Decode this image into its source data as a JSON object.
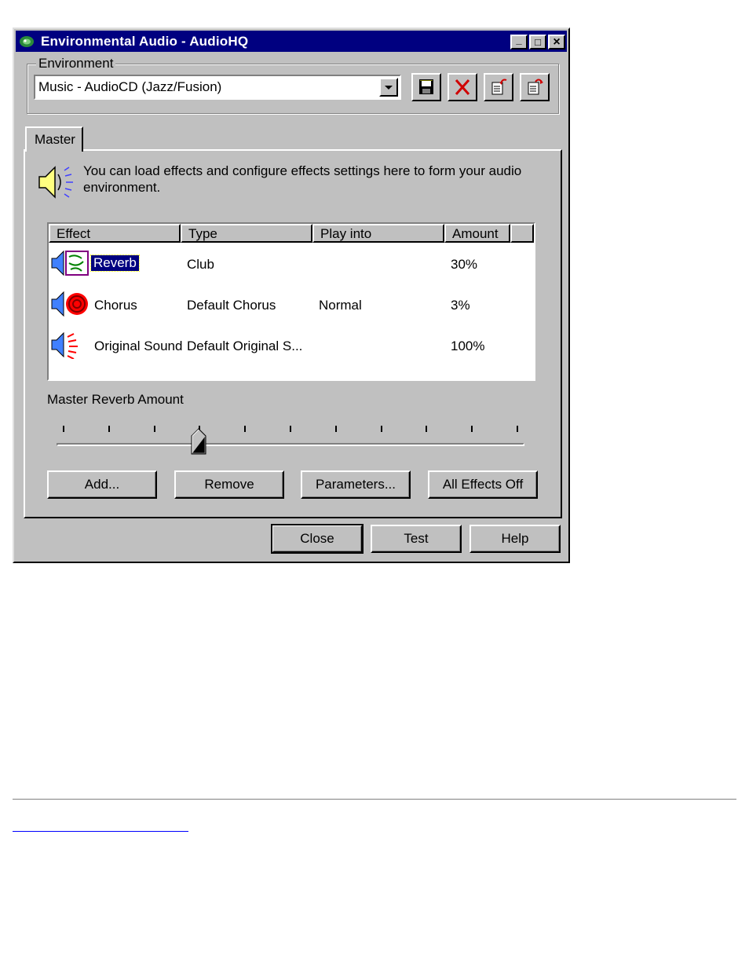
{
  "window": {
    "title": "Environmental Audio - AudioHQ",
    "controls": {
      "minimize": "_",
      "maximize": "□",
      "close": "×"
    }
  },
  "environment": {
    "group_label": "Environment",
    "selected": "Music - AudioCD (Jazz/Fusion)",
    "toolbar_icons": [
      "save-icon",
      "delete-icon",
      "import-icon",
      "export-icon"
    ]
  },
  "tabs": [
    {
      "label": "Master"
    }
  ],
  "info_text": "You can load effects and configure effects settings here to form your audio environment.",
  "effects_table": {
    "columns": [
      "Effect",
      "Type",
      "Play into",
      "Amount"
    ],
    "rows": [
      {
        "effect": "Reverb",
        "type": "Club",
        "play_into": "",
        "amount": "30%",
        "selected": true
      },
      {
        "effect": "Chorus",
        "type": "Default Chorus",
        "play_into": "Normal",
        "amount": "3%"
      },
      {
        "effect": "Original Sound",
        "type": "Default Original S...",
        "play_into": "",
        "amount": "100%"
      }
    ]
  },
  "slider": {
    "label": "Master Reverb Amount",
    "value_fraction": 0.3,
    "tick_count": 11
  },
  "actions": {
    "add": "Add...",
    "remove": "Remove",
    "parameters": "Parameters...",
    "all_effects_off": "All Effects Off"
  },
  "footer_buttons": {
    "close": "Close",
    "test": "Test",
    "help": "Help"
  },
  "colors": {
    "titlebar": "#000080",
    "face": "#c0c0c0",
    "selection": "#000080"
  }
}
